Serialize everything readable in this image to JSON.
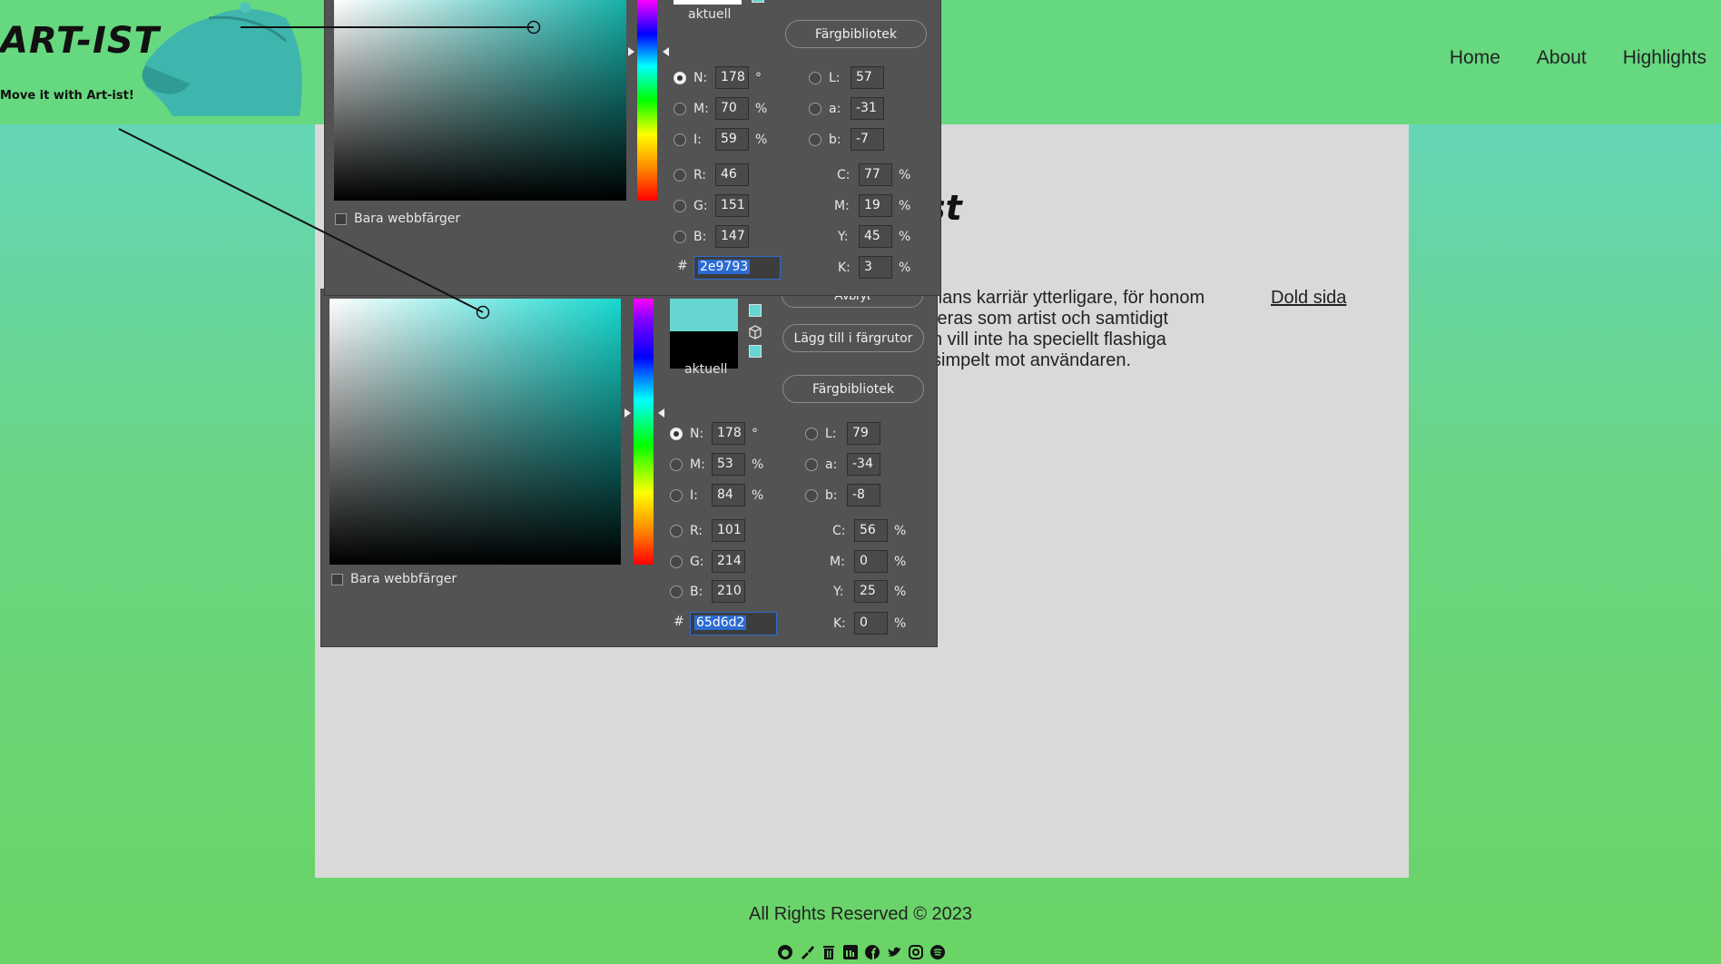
{
  "header": {
    "logo": "ART-IST",
    "tagline": "Move it with Art-ist!",
    "nav": [
      "Home",
      "About",
      "Highlights"
    ]
  },
  "card": {
    "title_fragment": "st",
    "text_lines": [
      "hans karriär ytterligare, för honom",
      "teras som artist och samtidigt",
      "n vill inte ha speciellt flashiga",
      "simpelt mot användaren."
    ],
    "hidden_link": "Dold sida"
  },
  "footer": {
    "copyright": "All Rights Reserved © 2023",
    "social_icons": [
      "github-icon",
      "brush-icon",
      "trash-icon",
      "linkedin-icon",
      "facebook-icon",
      "twitter-icon",
      "instagram-icon",
      "spotify-icon"
    ]
  },
  "picker_top": {
    "current_label": "aktuell",
    "library_button": "Färgbibliotek",
    "web_colors_label": "Bara webbfärger",
    "fields": {
      "N": "178",
      "M": "70",
      "I": "59",
      "R": "46",
      "G": "151",
      "B": "147",
      "L": "57",
      "a": "-31",
      "b": "-7",
      "C": "77",
      "Mc": "19",
      "Y": "45",
      "K": "3"
    },
    "hex": "2e9793",
    "units": {
      "deg": "°",
      "pct": "%",
      "hash": "#"
    }
  },
  "picker_bottom": {
    "cancel_button": "Avbryt",
    "add_swatch_button": "Lägg till i färgrutor",
    "library_button": "Färgbibliotek",
    "current_label": "aktuell",
    "web_colors_label": "Bara webbfärger",
    "fields": {
      "N": "178",
      "M": "53",
      "I": "84",
      "R": "101",
      "G": "214",
      "B": "210",
      "L": "79",
      "a": "-34",
      "b": "-8",
      "C": "56",
      "Mc": "0",
      "Y": "25",
      "K": "0"
    },
    "hex": "65d6d2",
    "new_color": "#65d6d2",
    "current_color": "#000000"
  },
  "colors": {
    "header_bg": "#66d87f",
    "card_bg": "#d9d9d9",
    "picker_bg": "#535353",
    "accent_teal": "#65d6d2"
  }
}
